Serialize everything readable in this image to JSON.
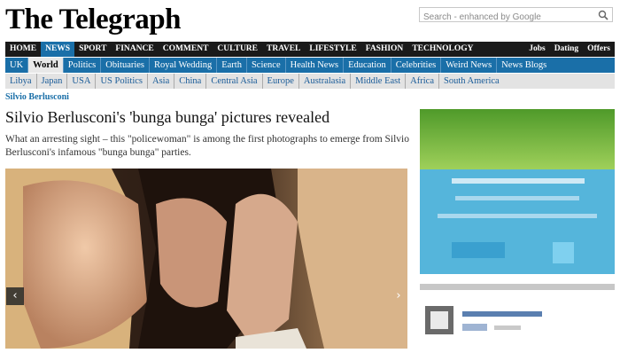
{
  "masthead": {
    "title": "The Telegraph"
  },
  "search": {
    "placeholder": "Search - enhanced by Google"
  },
  "nav_primary": {
    "left": [
      "HOME",
      "NEWS",
      "SPORT",
      "FINANCE",
      "COMMENT",
      "CULTURE",
      "TRAVEL",
      "LIFESTYLE",
      "FASHION",
      "TECHNOLOGY"
    ],
    "right": [
      "Jobs",
      "Dating",
      "Offers"
    ]
  },
  "nav_secondary": [
    "UK",
    "World",
    "Politics",
    "Obituaries",
    "Royal Wedding",
    "Earth",
    "Science",
    "Health News",
    "Education",
    "Celebrities",
    "Weird News",
    "News Blogs"
  ],
  "nav_tertiary": [
    "Libya",
    "Japan",
    "USA",
    "US Politics",
    "Asia",
    "China",
    "Central Asia",
    "Europe",
    "Australasia",
    "Middle East",
    "Africa",
    "South America"
  ],
  "article": {
    "section": "Silvio Berlusconi",
    "headline": "Silvio Berlusconi's 'bunga bunga' pictures revealed",
    "standfirst": "What an arresting sight – this \"policewoman\" is among the first photographs to emerge from Silvio Berlusconi's infamous \"bunga bunga\" parties."
  },
  "gallery": {
    "prev": "‹",
    "next": "›"
  },
  "colors": {
    "nav_primary_bg": "#1a1a1a",
    "nav_active": "#1a6fa8",
    "nav_secondary_bg": "#1a6fa8",
    "nav_tertiary_bg": "#e3e3e3",
    "link": "#1a5c99"
  }
}
